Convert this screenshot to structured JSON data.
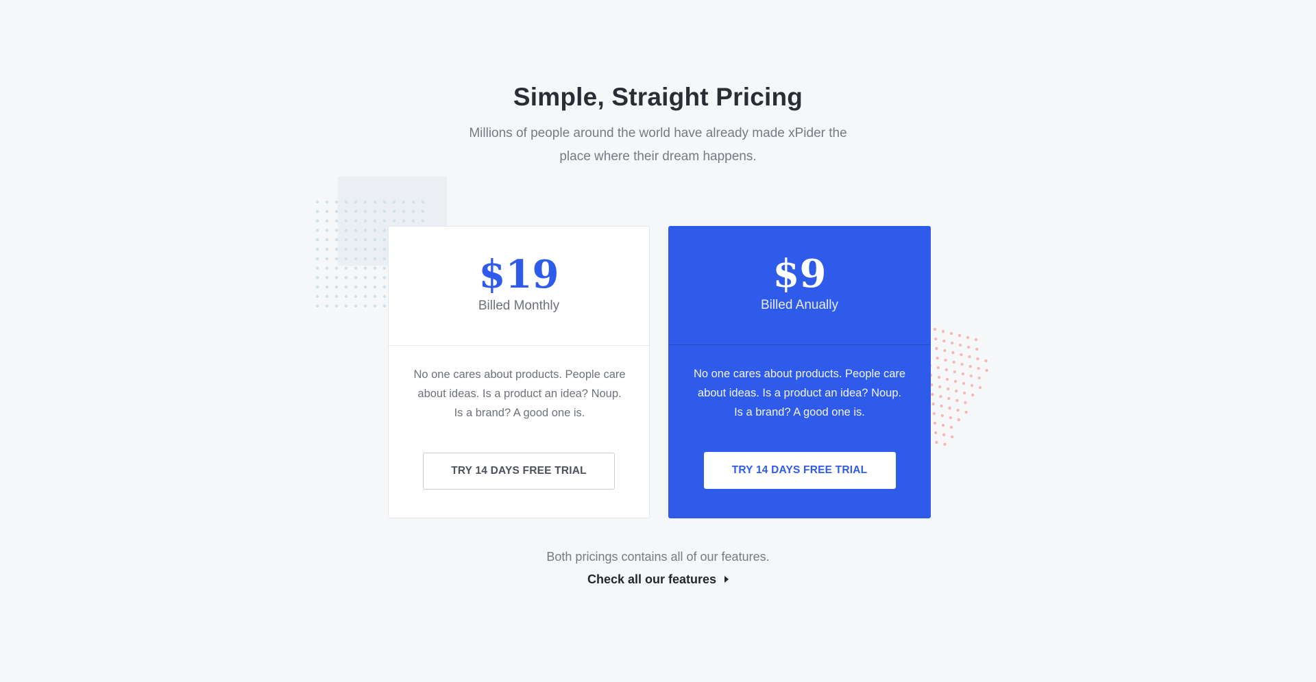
{
  "section": {
    "title": "Simple, Straight Pricing",
    "subtitle": "Millions of people around the world have already made xPider the place where their dream happens."
  },
  "plans": [
    {
      "price": "$19",
      "billing": "Billed Monthly",
      "description": "No one cares about products. People care about ideas. Is a product an idea? Noup. Is a brand? A good one is.",
      "cta_label": "TRY 14 DAYS FREE TRIAL"
    },
    {
      "price": "$9",
      "billing": "Billed Anually",
      "description": "No one cares about products. People care about ideas. Is a product an idea? Noup. Is a brand? A good one is.",
      "cta_label": "TRY 14 DAYS FREE TRIAL"
    }
  ],
  "footer": {
    "note": "Both pricings contains all of our features.",
    "link_label": "Check all our features",
    "link_icon": "caret-right-icon"
  },
  "colors": {
    "background": "#f6f7f9",
    "accent": "#2e5bea",
    "heading": "#2a2d33",
    "muted_text": "#767a82",
    "deco_dots_blue": "#cfe0e8",
    "deco_dots_pink": "#f6b8b4"
  }
}
